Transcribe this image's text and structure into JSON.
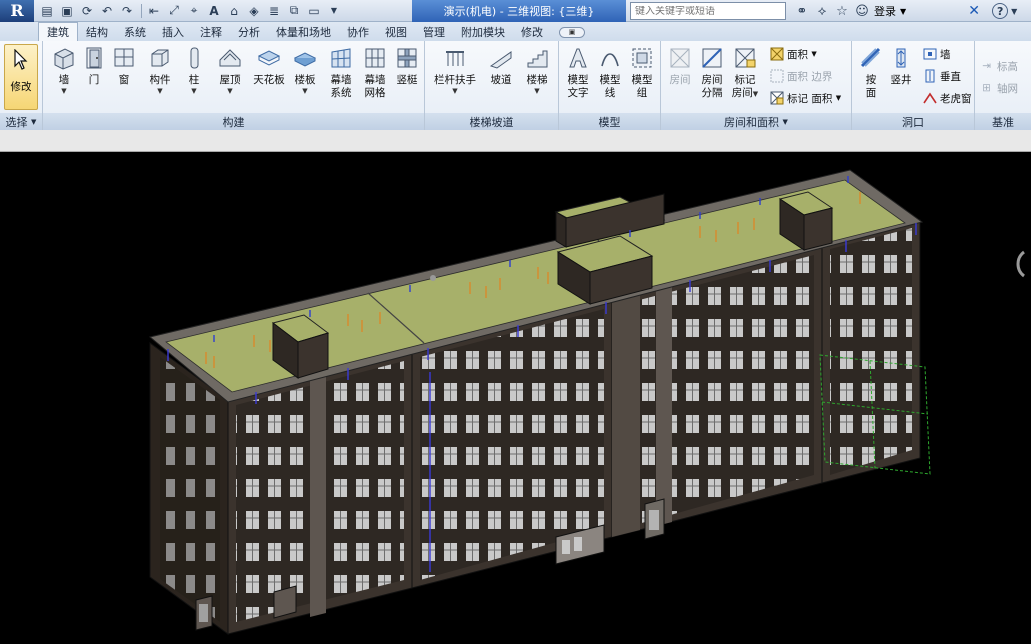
{
  "window": {
    "title": "演示(机电) - 三维视图: {三维}",
    "search_placeholder": "键入关键字或短语",
    "login_label": "登录"
  },
  "tabs": [
    {
      "label": "建筑",
      "active": true
    },
    {
      "label": "结构"
    },
    {
      "label": "系统"
    },
    {
      "label": "插入"
    },
    {
      "label": "注释"
    },
    {
      "label": "分析"
    },
    {
      "label": "体量和场地"
    },
    {
      "label": "协作"
    },
    {
      "label": "视图"
    },
    {
      "label": "管理"
    },
    {
      "label": "附加模块"
    },
    {
      "label": "修改"
    }
  ],
  "panels": {
    "select": {
      "title": "选择",
      "modify_label": "修改"
    },
    "build": {
      "title": "构建",
      "tools": [
        "墙",
        "门",
        "窗",
        "构件",
        "柱",
        "屋顶",
        "天花板",
        "楼板",
        "幕墙",
        "幕墙",
        "竖梃"
      ],
      "tool_sub": [
        "",
        "",
        "",
        "",
        "",
        "",
        "",
        "",
        "系统",
        "网格",
        ""
      ]
    },
    "circulation": {
      "title": "楼梯坡道",
      "tools": [
        "栏杆扶手",
        "坡道",
        "楼梯"
      ]
    },
    "model": {
      "title": "模型",
      "tools": [
        "模型",
        "模型",
        "模型"
      ],
      "tool_sub": [
        "文字",
        "线",
        "组"
      ]
    },
    "room_area": {
      "title": "房间和面积",
      "large_tools": [
        "房间",
        "房间",
        "标记"
      ],
      "large_sub": [
        "",
        "分隔",
        "房间"
      ],
      "small_tools": [
        "面积",
        "面积 边界",
        "标记 面积"
      ]
    },
    "opening": {
      "title": "洞口",
      "large_tools": [
        "按",
        "竖井"
      ],
      "large_sub": [
        "面",
        ""
      ],
      "small_tools": [
        "墙",
        "垂直",
        "老虎窗"
      ]
    },
    "datum": {
      "title": "基准",
      "small_tools": [
        "标高",
        "轴网"
      ]
    }
  },
  "colors": {
    "wall": "#3b332d",
    "roof": "#a7b06a",
    "window_glass": "#c8c8c8",
    "viewport_bg": "#000000",
    "title_active": "#2f63b6"
  }
}
